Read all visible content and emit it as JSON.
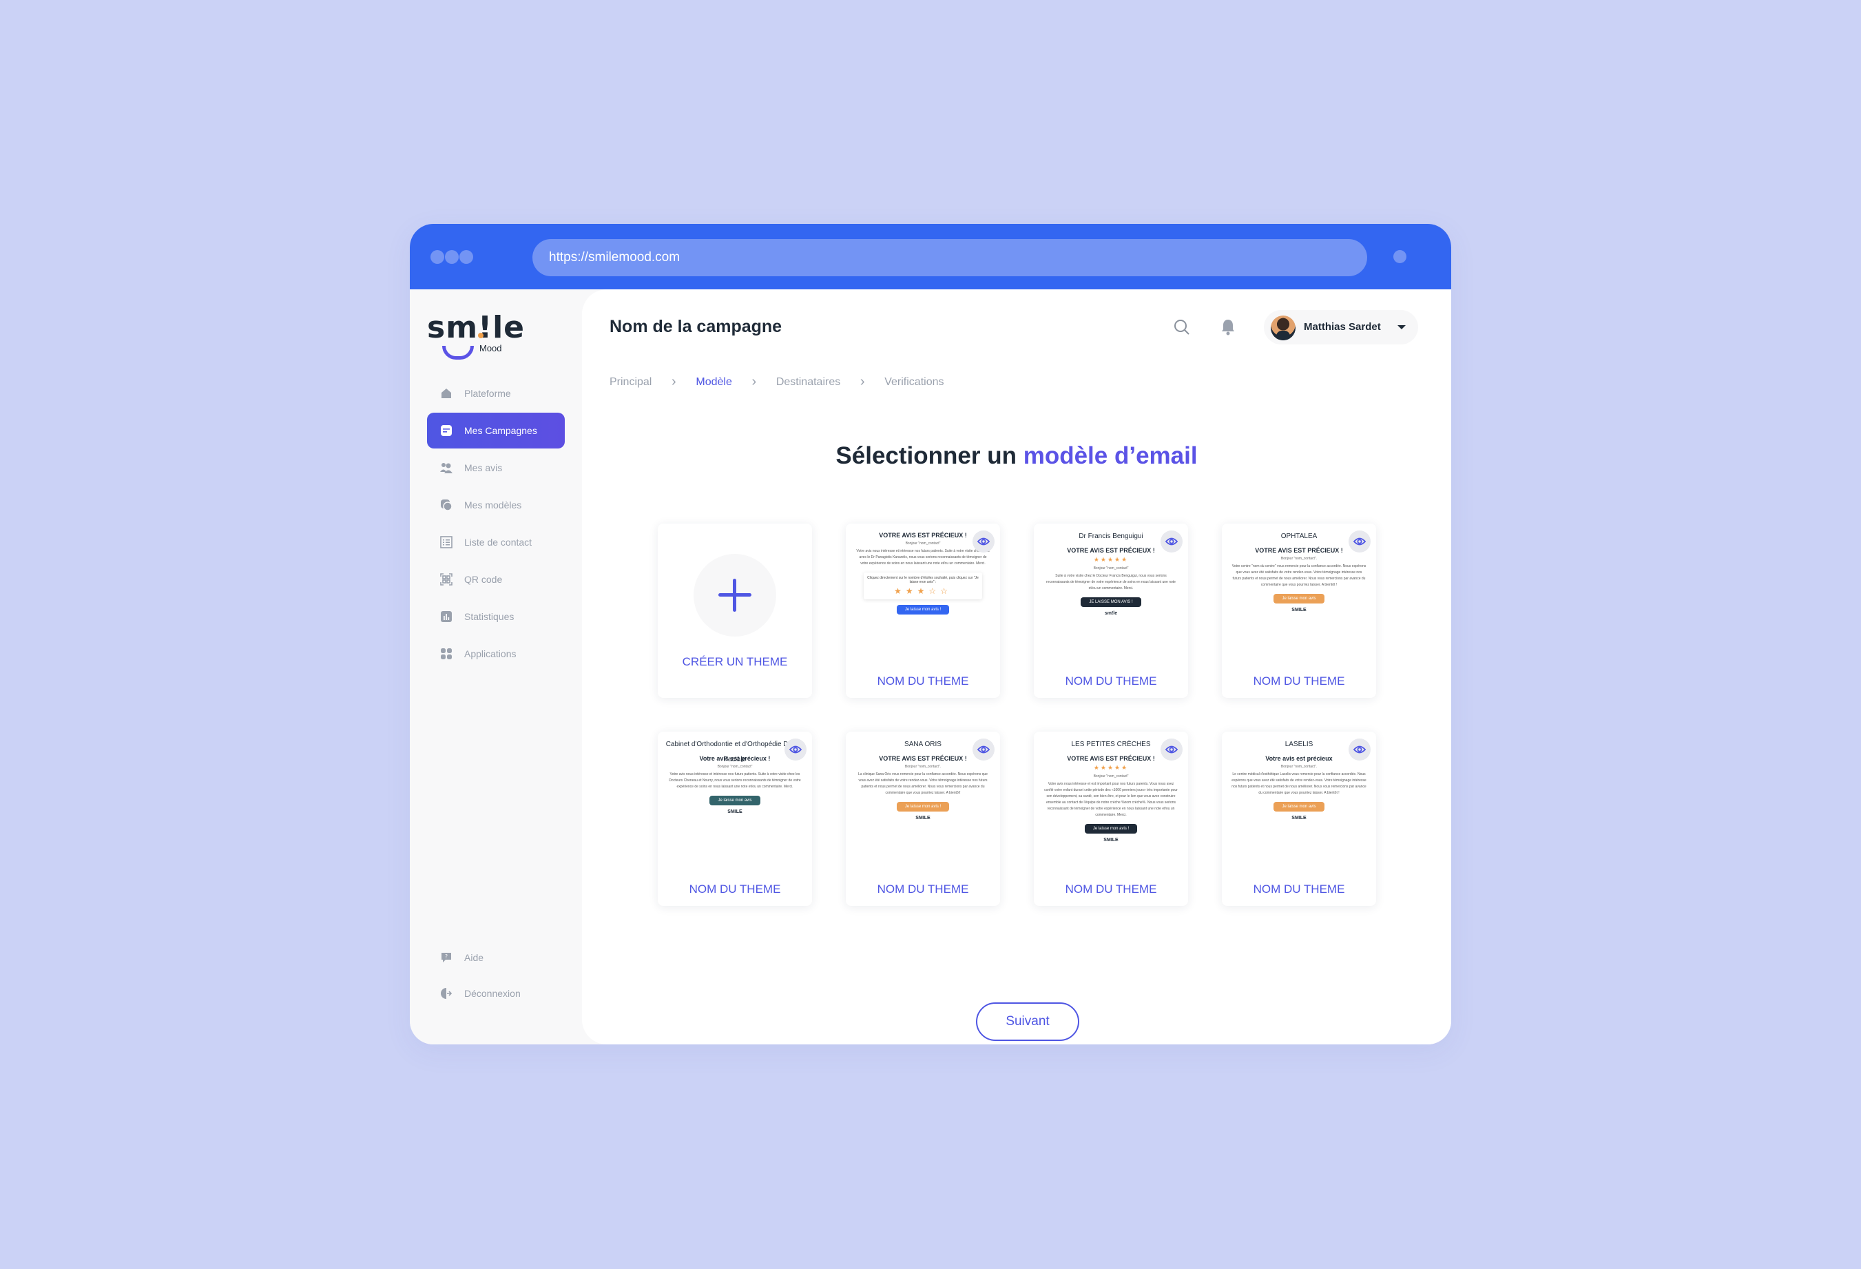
{
  "browser": {
    "url": "https://smilemood.com"
  },
  "brand": {
    "logo_text": "sm!le",
    "logo_subtext": "Mood",
    "primary_color": "#4f56e3",
    "browser_bar_color": "#3366f1",
    "accent_orange": "#f0a04b"
  },
  "sidebar": {
    "items": [
      {
        "label": "Plateforme",
        "icon": "home-icon",
        "active": false
      },
      {
        "label": "Mes Campagnes",
        "icon": "campaign-icon",
        "active": true
      },
      {
        "label": "Mes avis",
        "icon": "users-icon",
        "active": false
      },
      {
        "label": "Mes modèles",
        "icon": "templates-icon",
        "active": false
      },
      {
        "label": "Liste de contact",
        "icon": "list-icon",
        "active": false
      },
      {
        "label": "QR code",
        "icon": "qr-code-icon",
        "active": false
      },
      {
        "label": "Statistiques",
        "icon": "stats-icon",
        "active": false
      },
      {
        "label": "Applications",
        "icon": "apps-icon",
        "active": false
      }
    ],
    "bottom_items": [
      {
        "label": "Aide",
        "icon": "help-icon"
      },
      {
        "label": "Déconnexion",
        "icon": "logout-icon"
      }
    ]
  },
  "header": {
    "title": "Nom de la campagne",
    "user_name": "Matthias Sardet"
  },
  "steps": [
    {
      "label": "Principal",
      "active": false
    },
    {
      "label": "Modèle",
      "active": true
    },
    {
      "label": "Destinataires",
      "active": false
    },
    {
      "label": "Verifications",
      "active": false
    }
  ],
  "main": {
    "heading_prefix": "Sélectionner un",
    "heading_accent": "modèle d’email",
    "create_label": "CRÉER UN THEME",
    "next_label": "Suivant"
  },
  "templates": [
    {
      "name": "NOM DU THEME",
      "logo": "",
      "title": "VOTRE AVIS EST PRÉCIEUX !",
      "greeting": "Bonjour \"nom_contact\"",
      "body": "Votre avis nous intéresse et intéresse nos futurs patients. Suite à votre visite chez nous avec le Dr Panagiotis Kanarelis, nous vous serions reconnaissants de témoigner de votre expérience de soins en nous laissant une note et/ou un commentaire. Merci.",
      "rating_prompt": "Cliquez directement sur le nombre d'étoiles souhaité, puis cliquez sur \"Je laisse mon avis\" :",
      "rating_value": 3,
      "rating_max": 5,
      "button": "Je laisse mon avis !",
      "button_color": "#3366f1"
    },
    {
      "name": "NOM DU THEME",
      "logo": "Dr Francis Benguigui",
      "title": "VOTRE AVIS EST PRÉCIEUX !",
      "stars": "★★★★★",
      "greeting": "Bonjour \"nom_contact\"",
      "body": "Suite à votre visite chez le Docteur Francis Benguigui, nous vous serions reconnaissants de témoigner de votre expérience de soins en nous laissant une note et/ou un commentaire. Merci.",
      "button": "JE LAISSE MON AVIS !",
      "button_color": "#1f2a37",
      "footer": "sm!le"
    },
    {
      "name": "NOM DU THEME",
      "logo": "OPHTALEA",
      "title": "VOTRE AVIS EST PRÉCIEUX !",
      "greeting": "Bonjour \"nom_contact\".",
      "body": "Votre centre \"nom du centre\" vous remercie pour la confiance accordée. Nous espérons que vous avez été satisfaits de votre rendez-vous. Votre témoignage intéresse nos futurs patients et nous permet de nous améliorer. Nous vous remercions par avance du commentaire que vous pourriez laisser. A bientôt !",
      "button": "Je laisse mon avis",
      "button_color": "#eba056",
      "footer": "SMILE"
    },
    {
      "name": "NOM DU THEME",
      "logo": "Cabinet d'Orthodontie et d'Orthopédie Dento-Faciale",
      "title": "Votre avis est précieux !",
      "greeting": "Bonjour \"nom_contact\"",
      "body": "Votre avis nous intéresse et intéresse nos futurs patients. Suite à votre visite chez les Docteurs Cheneau et Nourry, nous vous serions reconnaissants de témoigner de votre expérience de soins en nous laissant une note et/ou un commentaire. Merci.",
      "button": "Je laisse mon avis",
      "button_color": "#33646b",
      "footer": "SMILE"
    },
    {
      "name": "NOM DU THEME",
      "logo": "SANA ORIS",
      "title": "VOTRE AVIS EST PRÉCIEUX !",
      "greeting": "Bonjour \"nom_contact\".",
      "body": "La clinique Sana Oris vous remercie pour la confiance accordée. Nous espérons que vous avez été satisfaits de votre rendez-vous. Votre témoignage intéresse nos futurs patients et nous permet de nous améliorer. Nous vous remercions par avance du commentaire que vous pourriez laisser. A bientôt!",
      "button": "Je laisse mon avis !",
      "button_color": "#eba056",
      "footer": "SMILE"
    },
    {
      "name": "NOM DU THEME",
      "logo": "LES PETITES CRÈCHES",
      "title": "VOTRE AVIS EST PRÉCIEUX !",
      "stars": "★★★★★",
      "greeting": "Bonjour \"nom_contact\"",
      "body": "Votre avis nous intéresse et est important pour nos futurs parents. Vous nous avez confié votre enfant durant cette période des «1000 premiers jours» très importante pour son développement, sa santé, son bien-être, et pour le lien que vous avez construire ensemble au contact de l'équipe de notre crèche %nom crèche%. Nous vous serions reconnaissant de témoigner de votre expérience en nous laissant une note et/ou un commentaire. Merci.",
      "button": "Je laisse mon avis !",
      "button_color": "#1f2a37",
      "footer": "SMILE"
    },
    {
      "name": "NOM DU THEME",
      "logo": "LASELIS",
      "title": "Votre avis est précieux",
      "greeting": "Bonjour \"nom_contact\".",
      "body": "Le centre médical d'esthétique Laselis vous remercie pour la confiance accordée. Nous espérons que vous avez été satisfaits de votre rendez-vous. Votre témoignage intéresse nos futurs patients et nous permet de nous améliorer. Nous vous remercions par avance du commentaire que vous pourriez laisser. A bientôt !",
      "button": "Je laisse mon avis",
      "button_color": "#eba056",
      "footer": "SMILE"
    }
  ]
}
